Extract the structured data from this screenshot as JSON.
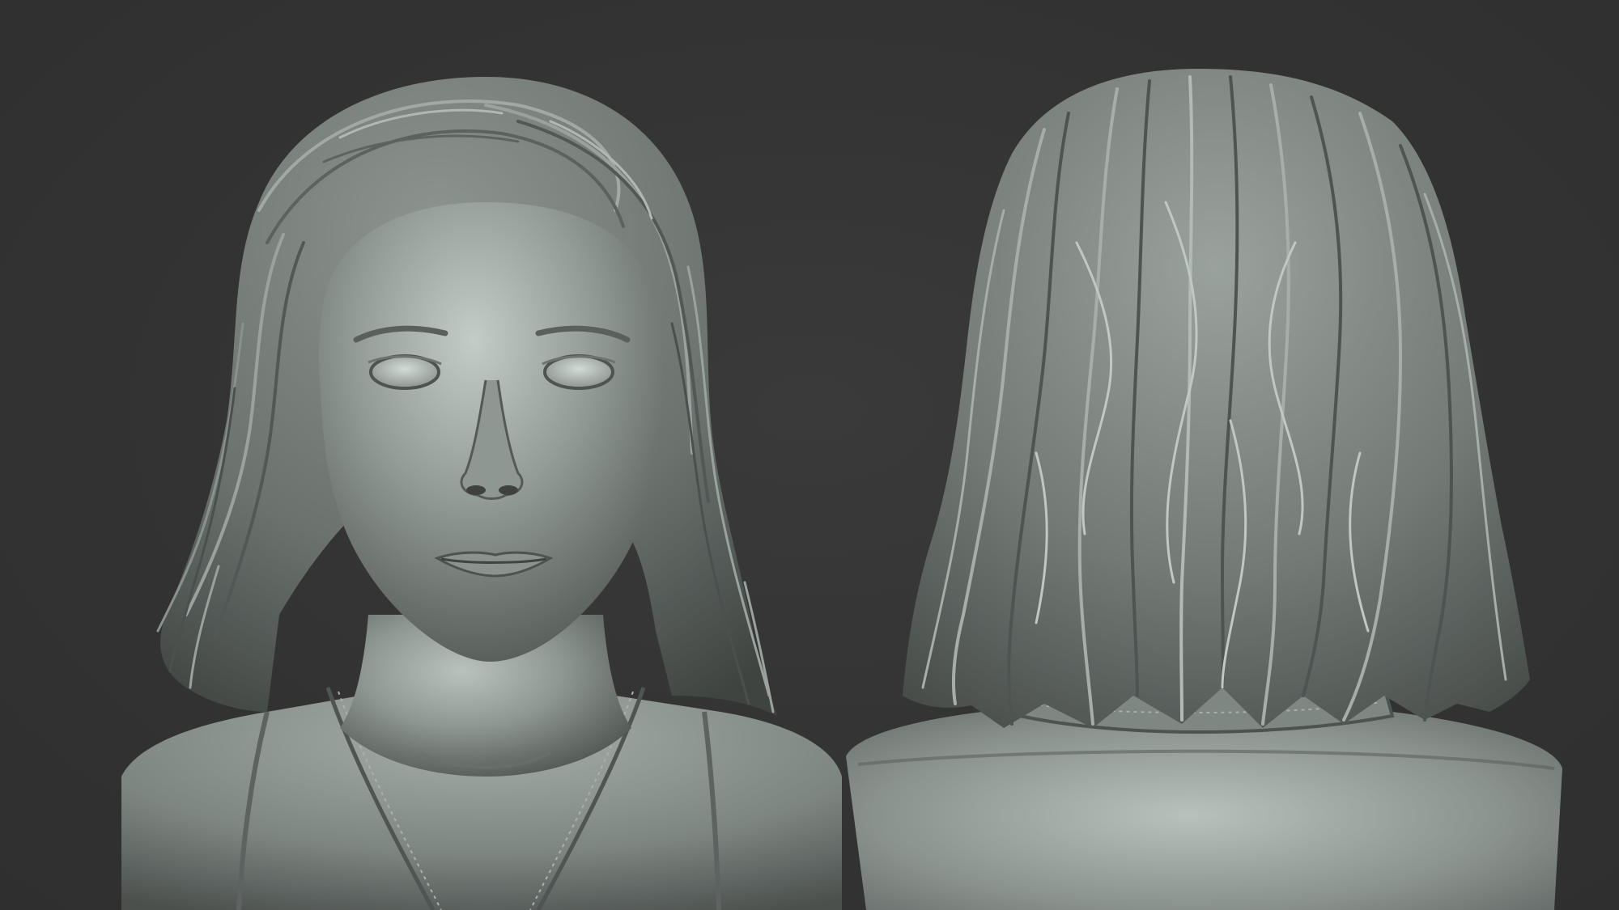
{
  "scene": {
    "background_color": "#333333",
    "material_color": "#8e9692",
    "views": [
      {
        "id": "front",
        "label": ""
      },
      {
        "id": "back",
        "label": ""
      }
    ]
  }
}
